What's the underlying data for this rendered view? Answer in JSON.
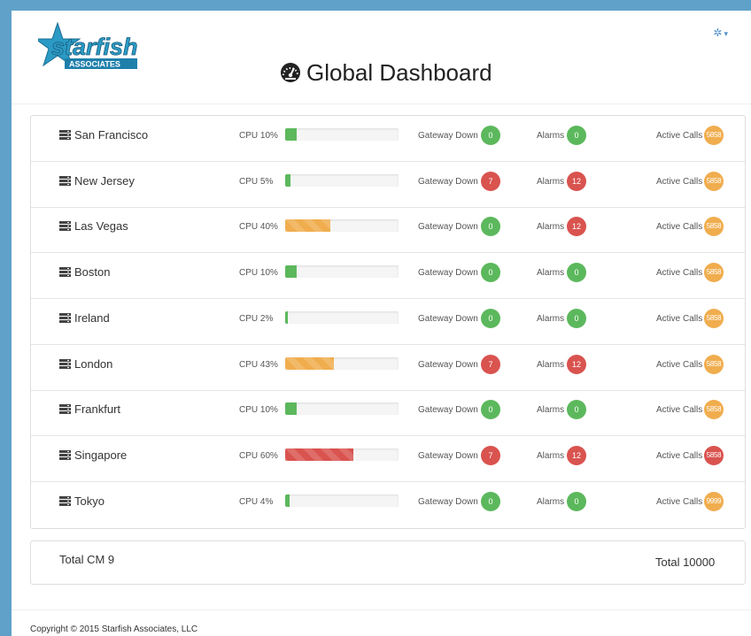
{
  "header": {
    "logo_text": "starfish",
    "logo_subtext": "ASSOCIATES",
    "title": "Global Dashboard",
    "settings_icon": "gear-icon",
    "settings_caret": "▾"
  },
  "labels": {
    "gateway_down": "Gateway Down",
    "alarms": "Alarms",
    "active_calls": "Active Calls"
  },
  "colors": {
    "green": "#5cb85c",
    "red": "#d9534f",
    "orange": "#f0ad4e",
    "accent": "#5fa1c8"
  },
  "sites": [
    {
      "name": "San Francisco",
      "cpu_label": "CPU 10%",
      "cpu": 10,
      "cpu_status": "green",
      "gateway_down": "0",
      "gateway_status": "green",
      "alarms": "0",
      "alarms_status": "green",
      "active_calls": "5858",
      "calls_status": "orange"
    },
    {
      "name": "New Jersey",
      "cpu_label": "CPU 5%",
      "cpu": 5,
      "cpu_status": "green",
      "gateway_down": "7",
      "gateway_status": "red",
      "alarms": "12",
      "alarms_status": "red",
      "active_calls": "5858",
      "calls_status": "orange"
    },
    {
      "name": "Las Vegas",
      "cpu_label": "CPU 40%",
      "cpu": 40,
      "cpu_status": "orange",
      "gateway_down": "0",
      "gateway_status": "green",
      "alarms": "12",
      "alarms_status": "red",
      "active_calls": "5858",
      "calls_status": "orange"
    },
    {
      "name": "Boston",
      "cpu_label": "CPU 10%",
      "cpu": 10,
      "cpu_status": "green",
      "gateway_down": "0",
      "gateway_status": "green",
      "alarms": "0",
      "alarms_status": "green",
      "active_calls": "5858",
      "calls_status": "orange"
    },
    {
      "name": "Ireland",
      "cpu_label": "CPU 2%",
      "cpu": 2,
      "cpu_status": "green",
      "gateway_down": "0",
      "gateway_status": "green",
      "alarms": "0",
      "alarms_status": "green",
      "active_calls": "5858",
      "calls_status": "orange"
    },
    {
      "name": "London",
      "cpu_label": "CPU 43%",
      "cpu": 43,
      "cpu_status": "orange",
      "gateway_down": "7",
      "gateway_status": "red",
      "alarms": "12",
      "alarms_status": "red",
      "active_calls": "5858",
      "calls_status": "orange"
    },
    {
      "name": "Frankfurt",
      "cpu_label": "CPU 10%",
      "cpu": 10,
      "cpu_status": "green",
      "gateway_down": "0",
      "gateway_status": "green",
      "alarms": "0",
      "alarms_status": "green",
      "active_calls": "5858",
      "calls_status": "orange"
    },
    {
      "name": "Singapore",
      "cpu_label": "CPU 60%",
      "cpu": 60,
      "cpu_status": "red",
      "gateway_down": "7",
      "gateway_status": "red",
      "alarms": "12",
      "alarms_status": "red",
      "active_calls": "5858",
      "calls_status": "red"
    },
    {
      "name": "Tokyo",
      "cpu_label": "CPU 4%",
      "cpu": 4,
      "cpu_status": "green",
      "gateway_down": "0",
      "gateway_status": "green",
      "alarms": "0",
      "alarms_status": "green",
      "active_calls": "9999",
      "calls_status": "orange"
    }
  ],
  "totals": {
    "total_cm": "Total CM 9",
    "total_calls": "Total 10000"
  },
  "footer": {
    "copyright": "Copyright © 2015 Starfish Associates, LLC"
  }
}
